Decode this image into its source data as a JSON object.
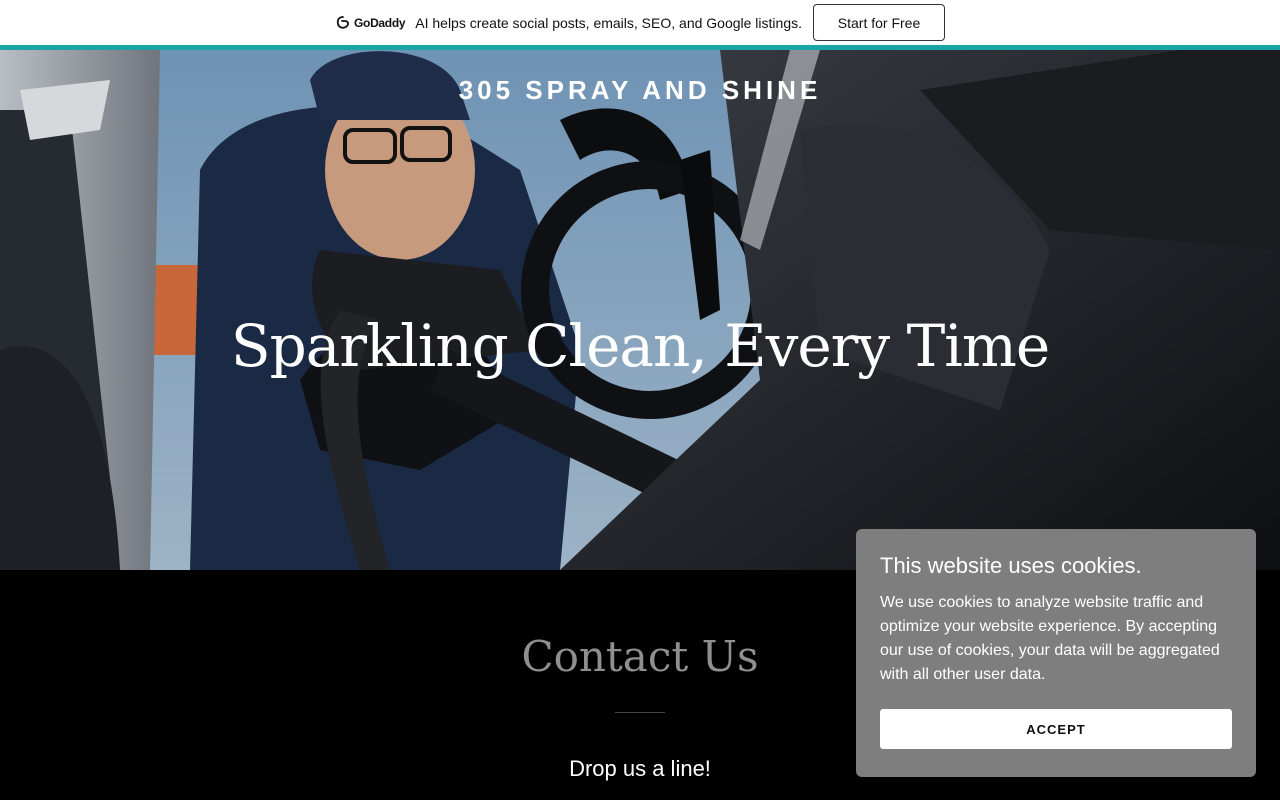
{
  "promo_bar": {
    "logo_text": "GoDaddy",
    "message": "AI helps create social posts, emails, SEO, and Google listings.",
    "cta_label": "Start for Free",
    "accent_color": "#1ba4a4"
  },
  "hero": {
    "brand": "305 SPRAY AND SHINE",
    "headline": "Sparkling Clean, Every Time"
  },
  "contact": {
    "title": "Contact Us",
    "subtitle": "Drop us a line!"
  },
  "cookie_banner": {
    "title": "This website uses cookies.",
    "body": "We use cookies to analyze website traffic and optimize your website experience. By accepting our use of cookies, your data will be aggregated with all other user data.",
    "accept_label": "ACCEPT"
  }
}
